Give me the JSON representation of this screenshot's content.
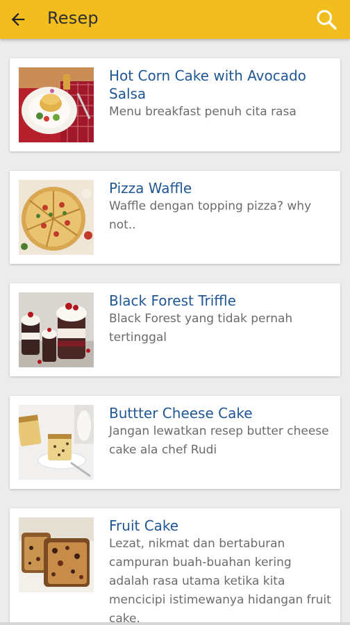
{
  "appbar": {
    "title": "Resep",
    "back_icon": "arrow-back-icon",
    "search_icon": "search-icon",
    "color": "#f2be1f"
  },
  "recipes": [
    {
      "title": "Hot Corn Cake with Avocado Salsa",
      "description": "Menu breakfast penuh cita rasa"
    },
    {
      "title": "Pizza Waffle",
      "description": "Waffle dengan topping pizza? why not.."
    },
    {
      "title": "Black Forest Triffle",
      "description": "Black Forest yang tidak pernah tertinggal"
    },
    {
      "title": "Buttter Cheese Cake",
      "description": "Jangan lewatkan resep butter cheese cake ala chef Rudi"
    },
    {
      "title": "Fruit Cake",
      "description": "Lezat, nikmat dan bertaburan campuran buah-buahan kering adalah rasa utama ketika kita mencicipi istimewanya hidangan fruit cake."
    }
  ],
  "colors": {
    "title_text": "#1f5694",
    "desc_text": "#6b6b6b",
    "background": "#ececec"
  }
}
